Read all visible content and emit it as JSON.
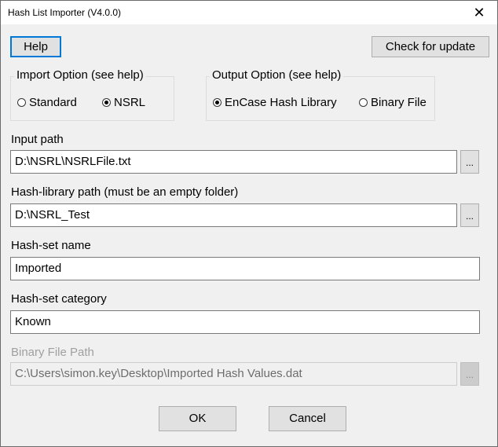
{
  "window": {
    "title": "Hash List Importer (V4.0.0)",
    "close_glyph": "✕"
  },
  "buttons": {
    "help": "Help",
    "check_update": "Check for update",
    "ok": "OK",
    "cancel": "Cancel"
  },
  "import_option": {
    "title": "Import Option (see help)",
    "options": [
      {
        "label": "Standard",
        "checked": false
      },
      {
        "label": "NSRL",
        "checked": true
      }
    ]
  },
  "output_option": {
    "title": "Output Option (see help)",
    "options": [
      {
        "label": "EnCase Hash Library",
        "checked": true
      },
      {
        "label": "Binary File",
        "checked": false
      }
    ]
  },
  "fields": {
    "input_path": {
      "label": "Input path",
      "value": "D:\\NSRL\\NSRLFile.txt",
      "browse": "..."
    },
    "hash_library_path": {
      "label": "Hash-library path (must be an empty folder)",
      "value": "D:\\NSRL_Test",
      "browse": "..."
    },
    "hash_set_name": {
      "label": "Hash-set name",
      "value": "Imported"
    },
    "hash_set_category": {
      "label": "Hash-set category",
      "value": "Known"
    },
    "binary_file_path": {
      "label": "Binary File Path",
      "value": "C:\\Users\\simon.key\\Desktop\\Imported Hash Values.dat",
      "browse": "...",
      "disabled": true
    }
  },
  "colors": {
    "focus_border": "#0078d7",
    "dialog_bg": "#f0f0f0",
    "button_bg": "#e1e1e1",
    "disabled_text": "#a0a0a0"
  }
}
